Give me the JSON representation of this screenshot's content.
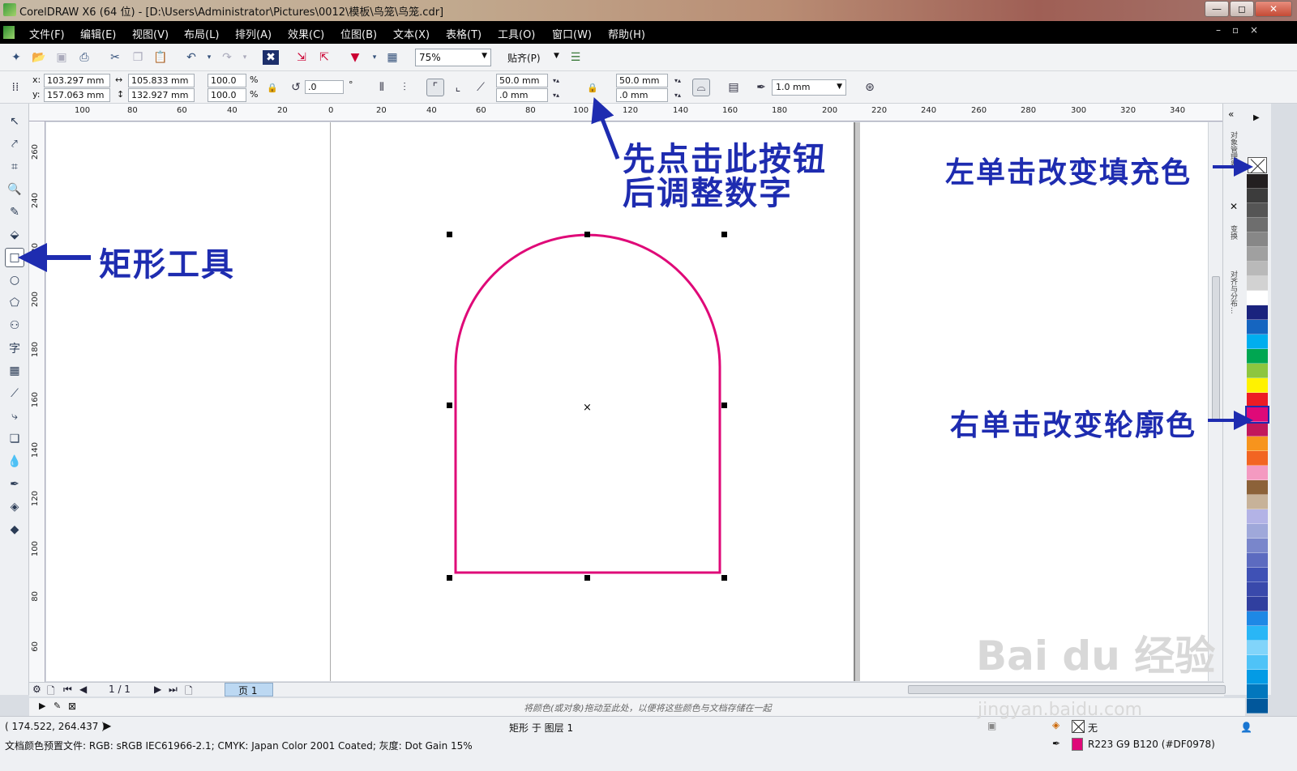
{
  "window": {
    "title": "CorelDRAW X6 (64 位) - [D:\\Users\\Administrator\\Pictures\\0012\\模板\\鸟笼\\鸟笼.cdr]",
    "minimize": "—",
    "maximize": "◻",
    "close": "✕"
  },
  "menu": {
    "items": [
      "文件(F)",
      "编辑(E)",
      "视图(V)",
      "布局(L)",
      "排列(A)",
      "效果(C)",
      "位图(B)",
      "文本(X)",
      "表格(T)",
      "工具(O)",
      "窗口(W)",
      "帮助(H)"
    ],
    "controls": [
      "–",
      "▫",
      "×"
    ]
  },
  "toolbar": {
    "zoom": "75%",
    "snap": "贴齐(P)"
  },
  "propbar": {
    "x_label": "x:",
    "x": "103.297 mm",
    "y_label": "y:",
    "y": "157.063 mm",
    "width": "105.833 mm",
    "height": "132.927 mm",
    "scale_x": "100.0",
    "scale_y": "100.0",
    "percent": "%",
    "rotation": ".0",
    "degree": "°",
    "corner_tl": "50.0 mm",
    "corner_bl": ".0 mm",
    "corner_tr": "50.0 mm",
    "corner_br": ".0 mm",
    "outline_width": "1.0 mm"
  },
  "ruler": {
    "h_ticks": [
      "100",
      "80",
      "60",
      "40",
      "20",
      "0",
      "20",
      "40",
      "60",
      "80",
      "100",
      "120",
      "140",
      "160",
      "180",
      "200",
      "220",
      "240",
      "260",
      "280",
      "300",
      "320",
      "340"
    ],
    "unit": "毫米",
    "v_ticks": [
      "260",
      "240",
      "220",
      "200",
      "180",
      "160",
      "140",
      "120",
      "100",
      "80",
      "60"
    ]
  },
  "pagebar": {
    "page_count": "1 / 1",
    "page_tab": "页 1"
  },
  "color_hint": "将颜色(或对象)拖动至此处，以便将这些颜色与文档存储在一起",
  "status": {
    "coords": "( 174.522, 264.437 )",
    "object_info": "矩形 于 图层 1",
    "color_profile": "文档颜色预置文件: RGB: sRGB IEC61966-2.1; CMYK: Japan Color 2001 Coated; 灰度: Dot Gain 15%",
    "fill": "无",
    "outline": "R223 G9 B120 (#DF0978)"
  },
  "docker": {
    "tab1": "对象管理器",
    "tab2": "变换",
    "tab3": "对齐与分布..."
  },
  "annotations": {
    "tip1_line1": "先点击此按钮",
    "tip1_line2": "后调整数字",
    "tip_rect": "矩形工具",
    "tip_fill": "左单击改变填充色",
    "tip_outline": "右单击改变轮廓色"
  },
  "watermark": {
    "brand": "Bai du 经验",
    "url": "jingyan.baidu.com"
  },
  "colors": {
    "shape_outline": "#DF0978",
    "annotation": "#1E2CB0",
    "palette": [
      "#ffffff",
      "#231f20",
      "#3c3c3c",
      "#555555",
      "#6e6e6e",
      "#878787",
      "#a0a0a0",
      "#b9b9b9",
      "#d2d2d2",
      "#ffffff",
      "#1a237e",
      "#1565c0",
      "#00aeef",
      "#00a651",
      "#8dc63f",
      "#fff200",
      "#ed1c24",
      "#df0978",
      "#c2185b",
      "#f7941d",
      "#f26522",
      "#f49ac1",
      "#8c6239",
      "#c7b299",
      "#b3b3e6",
      "#9fa8da",
      "#7986cb",
      "#5c6bc0",
      "#3f51b5",
      "#3949ab",
      "#303f9f",
      "#1e88e5",
      "#29b6f6",
      "#81d4fa",
      "#4fc3f7",
      "#039be5",
      "#0277bd",
      "#01579b"
    ]
  }
}
